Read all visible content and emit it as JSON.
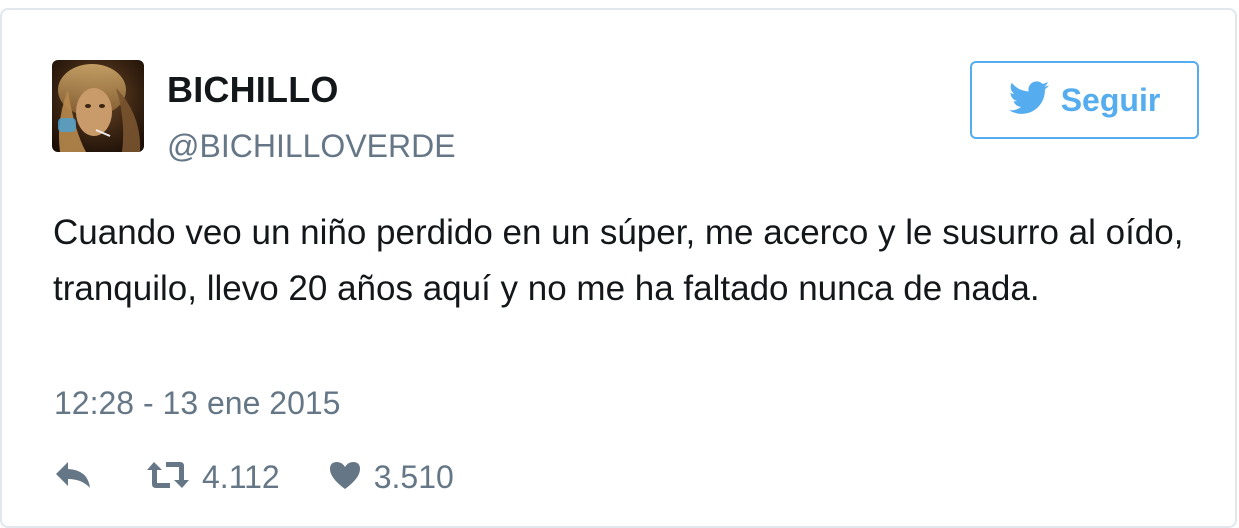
{
  "user": {
    "display_name": "BICHILLO",
    "handle": "@BICHILLOVERDE",
    "avatar_icon": "user-avatar-photo"
  },
  "follow_button": {
    "label": "Seguir",
    "icon": "twitter-bird-icon",
    "accent_color": "#55acee"
  },
  "tweet": {
    "text": "Cuando veo un niño perdido en un súper, me acerco y le susurro al oído, tranquilo, llevo 20 años aquí y no me ha faltado nunca de nada.",
    "timestamp": "12:28 - 13 ene 2015"
  },
  "actions": {
    "reply_icon": "reply-icon",
    "retweet_icon": "retweet-icon",
    "retweet_count": "4.112",
    "like_icon": "heart-icon",
    "like_count": "3.510"
  },
  "colors": {
    "text_primary": "#14171a",
    "text_secondary": "#657786",
    "border": "#e1e8ed"
  }
}
